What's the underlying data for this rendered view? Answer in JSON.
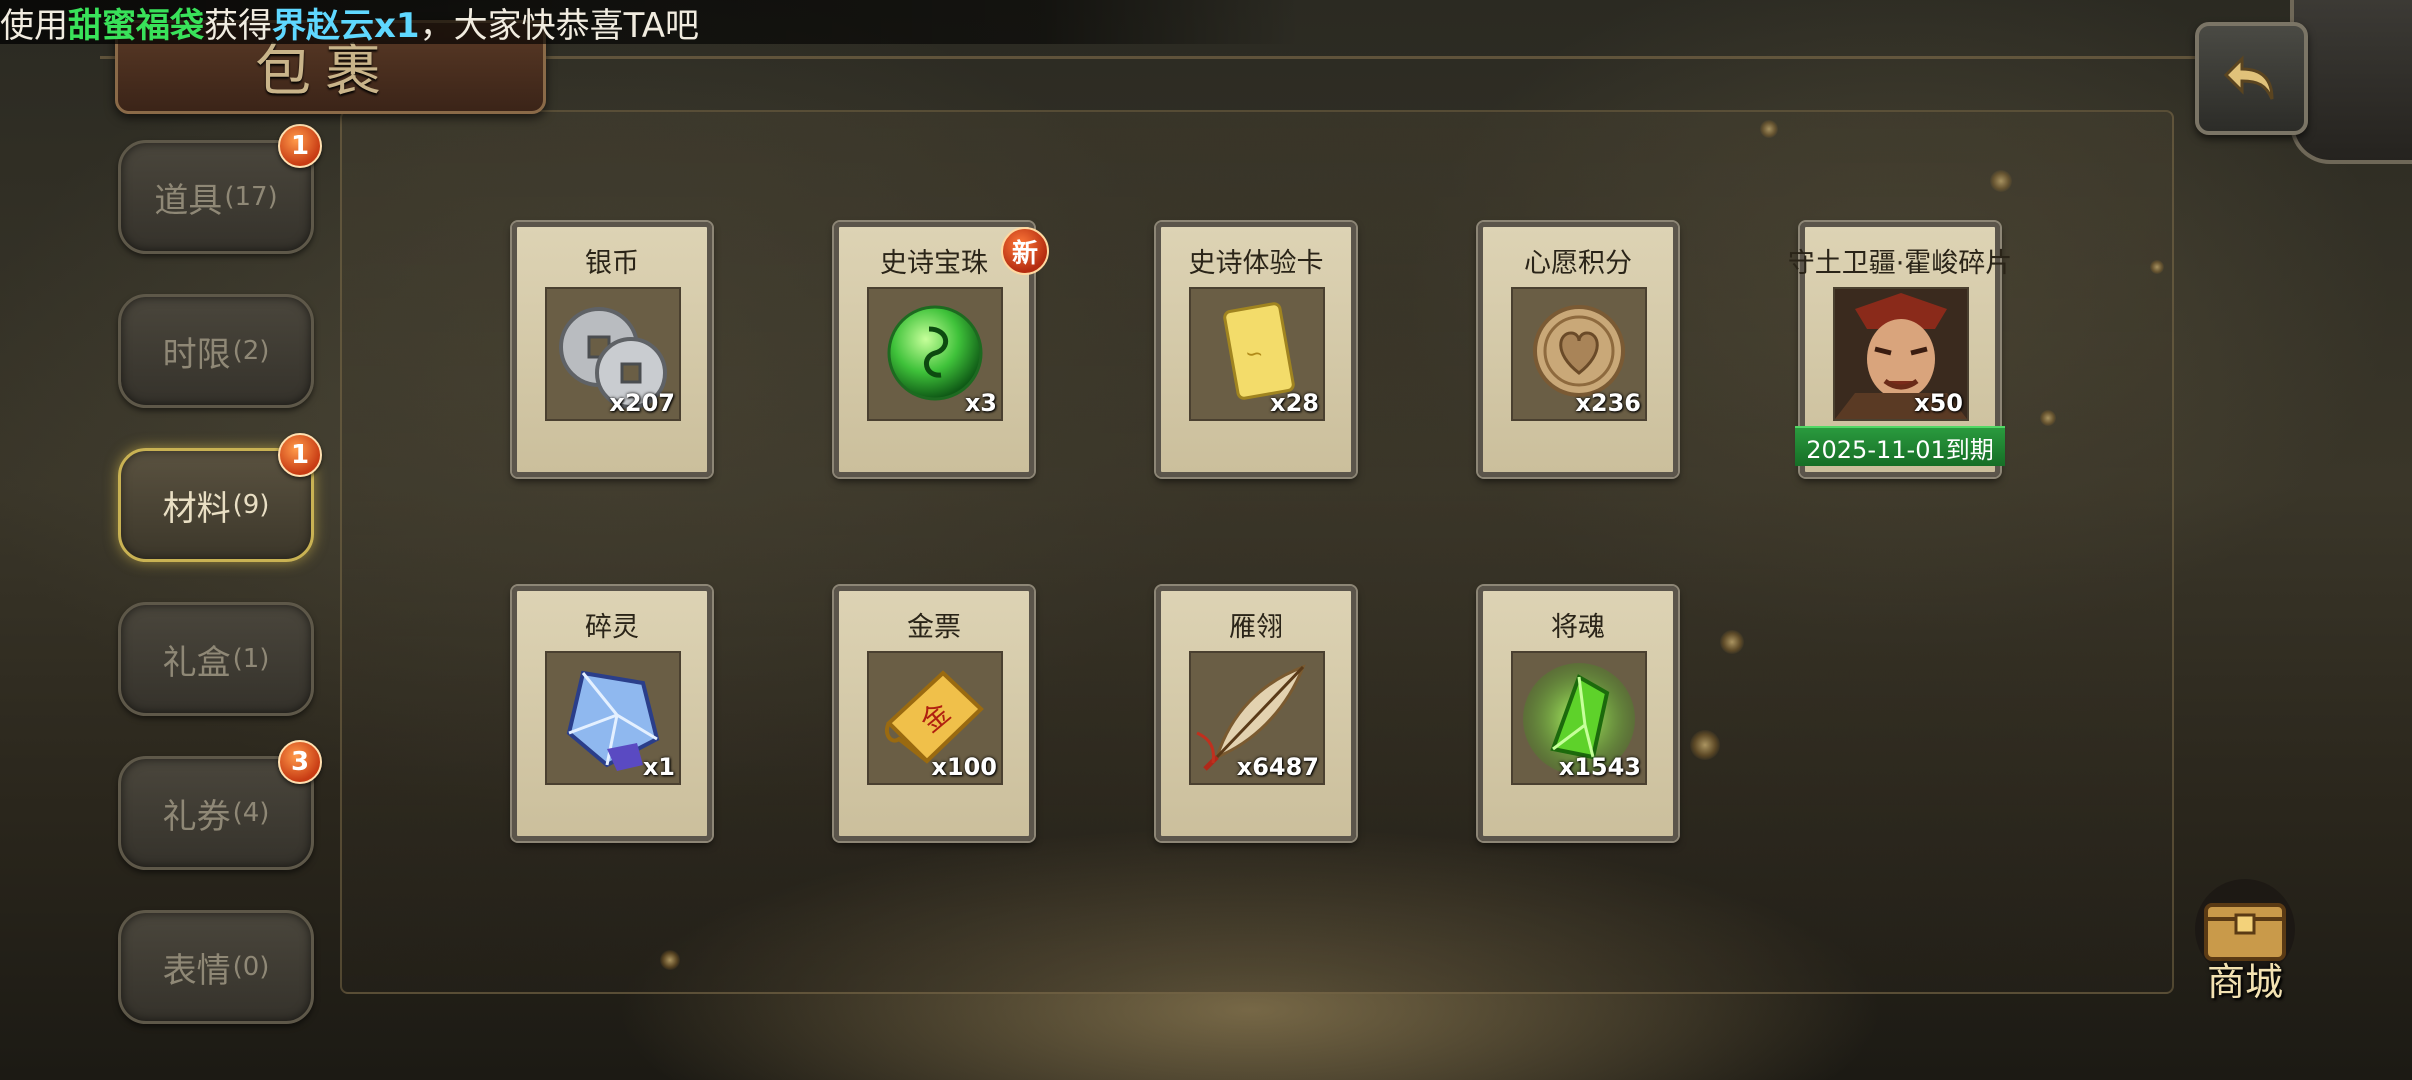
{
  "marquee": {
    "prefix": "使用",
    "item": "甜蜜福袋",
    "middle": "获得",
    "reward": "界赵云x1",
    "suffix": "，大家快恭喜TA吧"
  },
  "page": {
    "title": "包裹"
  },
  "tabs": [
    {
      "label": "道具",
      "count": "(17)",
      "badge": "1",
      "active": false
    },
    {
      "label": "时限",
      "count": "(2)",
      "badge": "",
      "active": false
    },
    {
      "label": "材料",
      "count": "(9)",
      "badge": "1",
      "active": true
    },
    {
      "label": "礼盒",
      "count": "(1)",
      "badge": "",
      "active": false
    },
    {
      "label": "礼券",
      "count": "(4)",
      "badge": "3",
      "active": false
    },
    {
      "label": "表情",
      "count": "(0)",
      "badge": "",
      "active": false
    }
  ],
  "items": [
    {
      "name": "银币",
      "qty": "x207",
      "icon": "silver-coin-icon"
    },
    {
      "name": "史诗宝珠",
      "qty": "x3",
      "icon": "epic-orb-icon",
      "new_badge": "新"
    },
    {
      "name": "史诗体验卡",
      "qty": "x28",
      "icon": "epic-trial-card-icon"
    },
    {
      "name": "心愿积分",
      "qty": "x236",
      "icon": "wish-point-coin-icon"
    },
    {
      "name": "守土卫疆·霍峻碎片",
      "qty": "x50",
      "icon": "general-portrait-icon",
      "expire": "2025-11-01到期"
    },
    {
      "name": "碎灵",
      "qty": "x1",
      "icon": "spirit-crystal-icon"
    },
    {
      "name": "金票",
      "qty": "x100",
      "icon": "gold-ticket-scroll-icon"
    },
    {
      "name": "雁翎",
      "qty": "x6487",
      "icon": "feather-icon"
    },
    {
      "name": "将魂",
      "qty": "x1543",
      "icon": "general-soul-gem-icon"
    }
  ],
  "shop": {
    "label": "商城"
  },
  "colors": {
    "active_tab_border": "#c9b253",
    "badge": "#c83c14",
    "expire_bar": "#1c8a32",
    "marquee_green": "#39e25a",
    "marquee_blue": "#5fd8ff"
  }
}
